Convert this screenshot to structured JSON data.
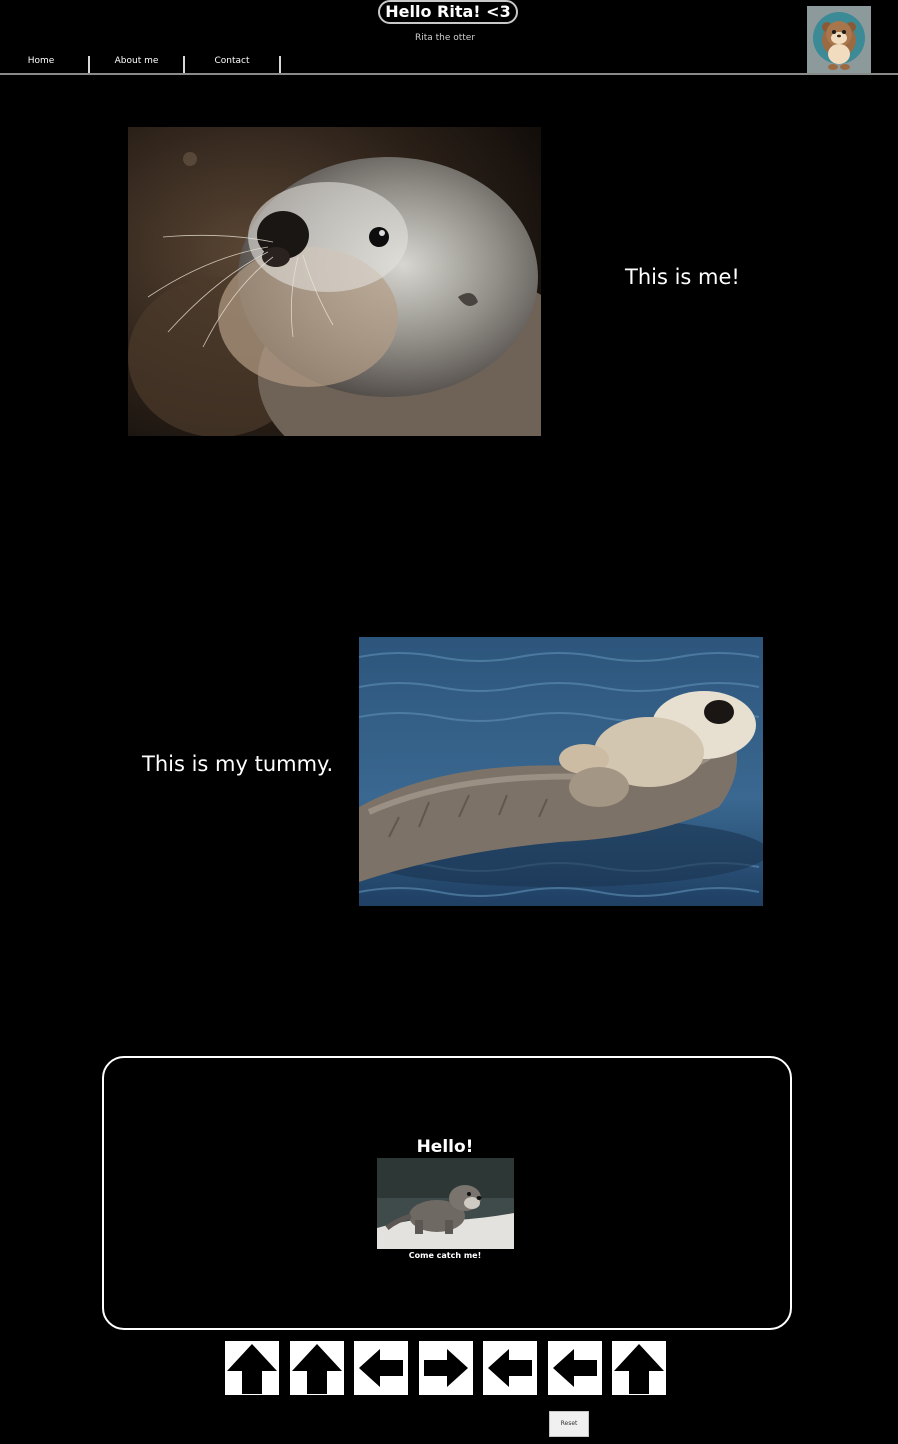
{
  "header": {
    "title": "Hello Rita! <3",
    "subtitle": "Rita the otter",
    "avatar_icon": "otter-cartoon-avatar"
  },
  "nav": {
    "items": [
      {
        "label": "Home"
      },
      {
        "label": "About me"
      },
      {
        "label": "Contact"
      }
    ]
  },
  "sections": {
    "first_caption": "This is me!",
    "second_caption": "This is my tummy."
  },
  "game": {
    "title": "Hello!",
    "caption": "Come catch me!",
    "arrows": [
      "up",
      "up",
      "left",
      "right",
      "left",
      "left",
      "up"
    ],
    "reset_label": "Reset"
  },
  "colors": {
    "background": "#000000",
    "text": "#ffffff",
    "title_border": "#c8c8c8",
    "water": "#2e5a86"
  }
}
